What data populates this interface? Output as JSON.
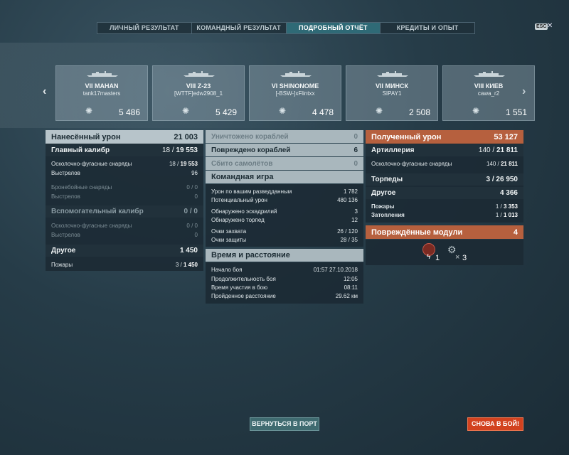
{
  "tabs": [
    {
      "label": "ЛИЧНЫЙ РЕЗУЛЬТАТ"
    },
    {
      "label": "КОМАНДНЫЙ РЕЗУЛЬТАТ"
    },
    {
      "label": "ПОДРОБНЫЙ ОТЧЁТ"
    },
    {
      "label": "КРЕДИТЫ И ОПЫТ"
    }
  ],
  "esc_label": "ESC",
  "nav": {
    "prev": "‹",
    "next": "›"
  },
  "ships": [
    {
      "name": "VII MAHAN",
      "player": "tank17masters",
      "damage": "5 486"
    },
    {
      "name": "VIII Z-23",
      "player": "[WTTF]edw2908_1",
      "damage": "5 429"
    },
    {
      "name": "VI SHINONOME",
      "player": "[-BSW-]xFlintxx",
      "damage": "4 478"
    },
    {
      "name": "VII МИНСК",
      "player": "SIPAY1",
      "damage": "2 508"
    },
    {
      "name": "VIII КИЕВ",
      "player": "cawa_r2",
      "damage": "1 551"
    }
  ],
  "dealt": {
    "title": "Нанесённый урон",
    "total": "21 003",
    "main_caliber": {
      "label": "Главный калибр",
      "value_a": "18 /",
      "value_b": "19 553"
    },
    "he_label": "Осколочно-фугасные снаряды",
    "he_a": "18 /",
    "he_b": "19 553",
    "shots_label": "Выстрелов",
    "shots": "96",
    "ap_label": "Бронебойные снаряды",
    "ap": "0 / 0",
    "ap_shots_label": "Выстрелов",
    "ap_shots": "0",
    "secondary": {
      "label": "Вспомогательный калибр",
      "value": "0 / 0"
    },
    "sec_he_label": "Осколочно-фугасные снаряды",
    "sec_he": "0 / 0",
    "sec_shots_label": "Выстрелов",
    "sec_shots": "0",
    "other": {
      "label": "Другое",
      "value": "1 450"
    },
    "fires_label": "Пожары",
    "fires_a": "3 /",
    "fires_b": "1 450"
  },
  "middle": {
    "destroyed_label": "Уничтожено кораблей",
    "destroyed": "0",
    "damaged_label": "Повреждено кораблей",
    "damaged": "6",
    "planes_label": "Сбито самолётов",
    "planes": "0",
    "team_title": "Командная игра",
    "spotting_label": "Урон по вашим разведданным",
    "spotting": "1 782",
    "potential_label": "Потенциальный урон",
    "potential": "480 136",
    "squad_label": "Обнаружено эскадрилий",
    "squad": "3",
    "torp_det_label": "Обнаружено торпед",
    "torp_det": "12",
    "capture_label": "Очки захвата",
    "capture": "26 / 120",
    "defense_label": "Очки защиты",
    "defense": "28 / 35",
    "time_title": "Время и расстояние",
    "start_label": "Начало боя",
    "start": "01:57  27.10.2018",
    "duration_label": "Продолжительность боя",
    "duration": "12:05",
    "participation_label": "Время участия в бою",
    "participation": "08:11",
    "distance_label": "Пройденное расстояние",
    "distance": "29.62 км"
  },
  "received": {
    "title": "Полученный урон",
    "total": "53 127",
    "artillery_label": "Артиллерия",
    "artillery_a": "140 /",
    "artillery_b": "21 811",
    "he_label": "Осколочно-фугасные снаряды",
    "he_a": "140 /",
    "he_b": "21 811",
    "torpedoes_label": "Торпеды",
    "torpedoes": "3 / 26 950",
    "other_label": "Другое",
    "other": "4 366",
    "fires_label": "Пожары",
    "fires_a": "1 /",
    "fires_b": "3 353",
    "flooding_label": "Затопления",
    "flooding_a": "1 /",
    "flooding_b": "1 013",
    "modules_label": "Повреждённые модули",
    "modules": "4",
    "module_count_1": "1",
    "module_count_2": "3"
  },
  "buttons": {
    "port": "ВЕРНУТЬСЯ В ПОРТ",
    "battle": "СНОВА В БОЙ!"
  },
  "colors": {
    "accent_orange": "#b6603e",
    "active_tab": "#2f6a76",
    "battle_button": "#d2421f"
  }
}
